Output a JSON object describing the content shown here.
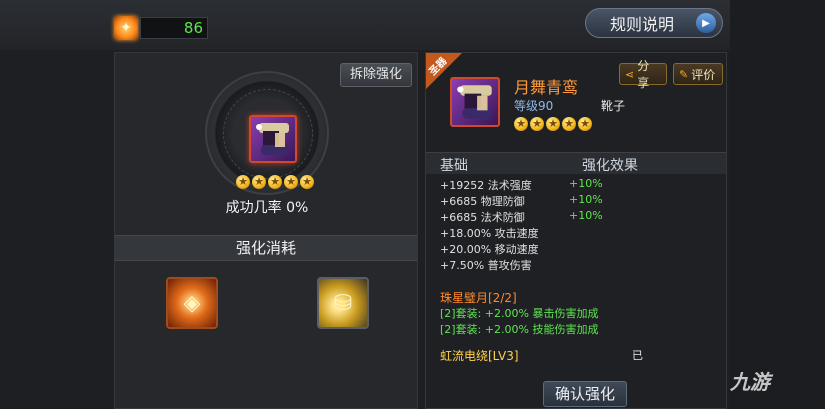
{
  "top_bar": {
    "currency_icon": "crystal-icon",
    "currency_value": "86",
    "rules_button_label": "规则说明"
  },
  "left_panel": {
    "remove_button_label": "拆除强化",
    "stars_count": 5,
    "success_rate": "成功几率 0%",
    "consume_header": "强化消耗",
    "materials": [
      {
        "name": "forge-stone-icon"
      },
      {
        "name": "gold-coins-icon"
      }
    ]
  },
  "right_panel": {
    "sacred_tag": "圣器",
    "item_name": "月舞青鸾",
    "item_level": "等级90",
    "item_type": "靴子",
    "stars_count": 5,
    "share_label": "分享",
    "rate_label": "评价",
    "stats_header": {
      "base": "基础",
      "bonus": "强化效果"
    },
    "stats": [
      {
        "name": "+19252 法术强度",
        "bonus": "+10%"
      },
      {
        "name": "+6685 物理防御",
        "bonus": "+10%"
      },
      {
        "name": "+6685 法术防御",
        "bonus": "+10%"
      },
      {
        "name": "+18.00% 攻击速度",
        "bonus": ""
      },
      {
        "name": "+20.00% 移动速度",
        "bonus": ""
      },
      {
        "name": "+7.50% 普攻伤害",
        "bonus": ""
      }
    ],
    "set_name": "珠星璧月[2/2]",
    "set_effects": [
      "[2]套装: +2.00% 暴击伤害加成",
      "[2]套装: +2.00% 技能伤害加成"
    ],
    "skill_name": "虹流电绕[LV3]",
    "skill_status": "已",
    "confirm_label": "确认强化"
  },
  "watermark": "九游",
  "colors": {
    "accent_orange": "#ff9a3a",
    "bonus_green": "#5ee64f",
    "skill_gold": "#ffd24a",
    "level_blue": "#8fb8e8"
  }
}
